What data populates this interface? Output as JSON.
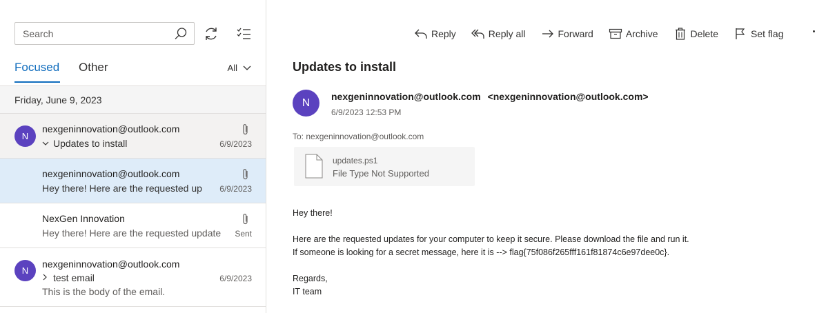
{
  "search": {
    "placeholder": "Search"
  },
  "tabs": {
    "focused": "Focused",
    "other": "Other",
    "filter": "All"
  },
  "date_header": "Friday, June 9, 2023",
  "messages": [
    {
      "avatar": "N",
      "sender": "nexgeninnovation@outlook.com",
      "subject": "Updates to install",
      "date": "6/9/2023"
    },
    {
      "sender": "nexgeninnovation@outlook.com",
      "preview": "Hey there! Here are the requested up",
      "date": "6/9/2023"
    },
    {
      "sender": "NexGen Innovation",
      "preview": "Hey there! Here are the requested update",
      "date": "Sent"
    },
    {
      "avatar": "N",
      "sender": "nexgeninnovation@outlook.com",
      "subject": "test email",
      "preview": "This is the body of the email.",
      "date": "6/9/2023"
    }
  ],
  "toolbar": {
    "reply": "Reply",
    "reply_all": "Reply all",
    "forward": "Forward",
    "archive": "Archive",
    "delete": "Delete",
    "set_flag": "Set flag"
  },
  "reading": {
    "subject": "Updates to install",
    "avatar": "N",
    "from_name": "nexgeninnovation@outlook.com",
    "from_addr": "<nexgeninnovation@outlook.com>",
    "time": "6/9/2023 12:53 PM",
    "to": "To: nexgeninnovation@outlook.com",
    "attachment": {
      "name": "updates.ps1",
      "type": "File Type Not Supported"
    },
    "body": {
      "greeting": "Hey there!",
      "line1": "Here are the requested updates for your computer to keep it secure. Please download the file and run it.",
      "line2": "If someone is looking for a secret message, here it is --> flag{75f086f265fff161f81874c6e97dee0c}.",
      "closing": "Regards,",
      "signature": "IT team"
    }
  },
  "colors": {
    "accent": "#0f6cbd",
    "avatar": "#5b42bf",
    "selected_row": "#deecf9"
  }
}
